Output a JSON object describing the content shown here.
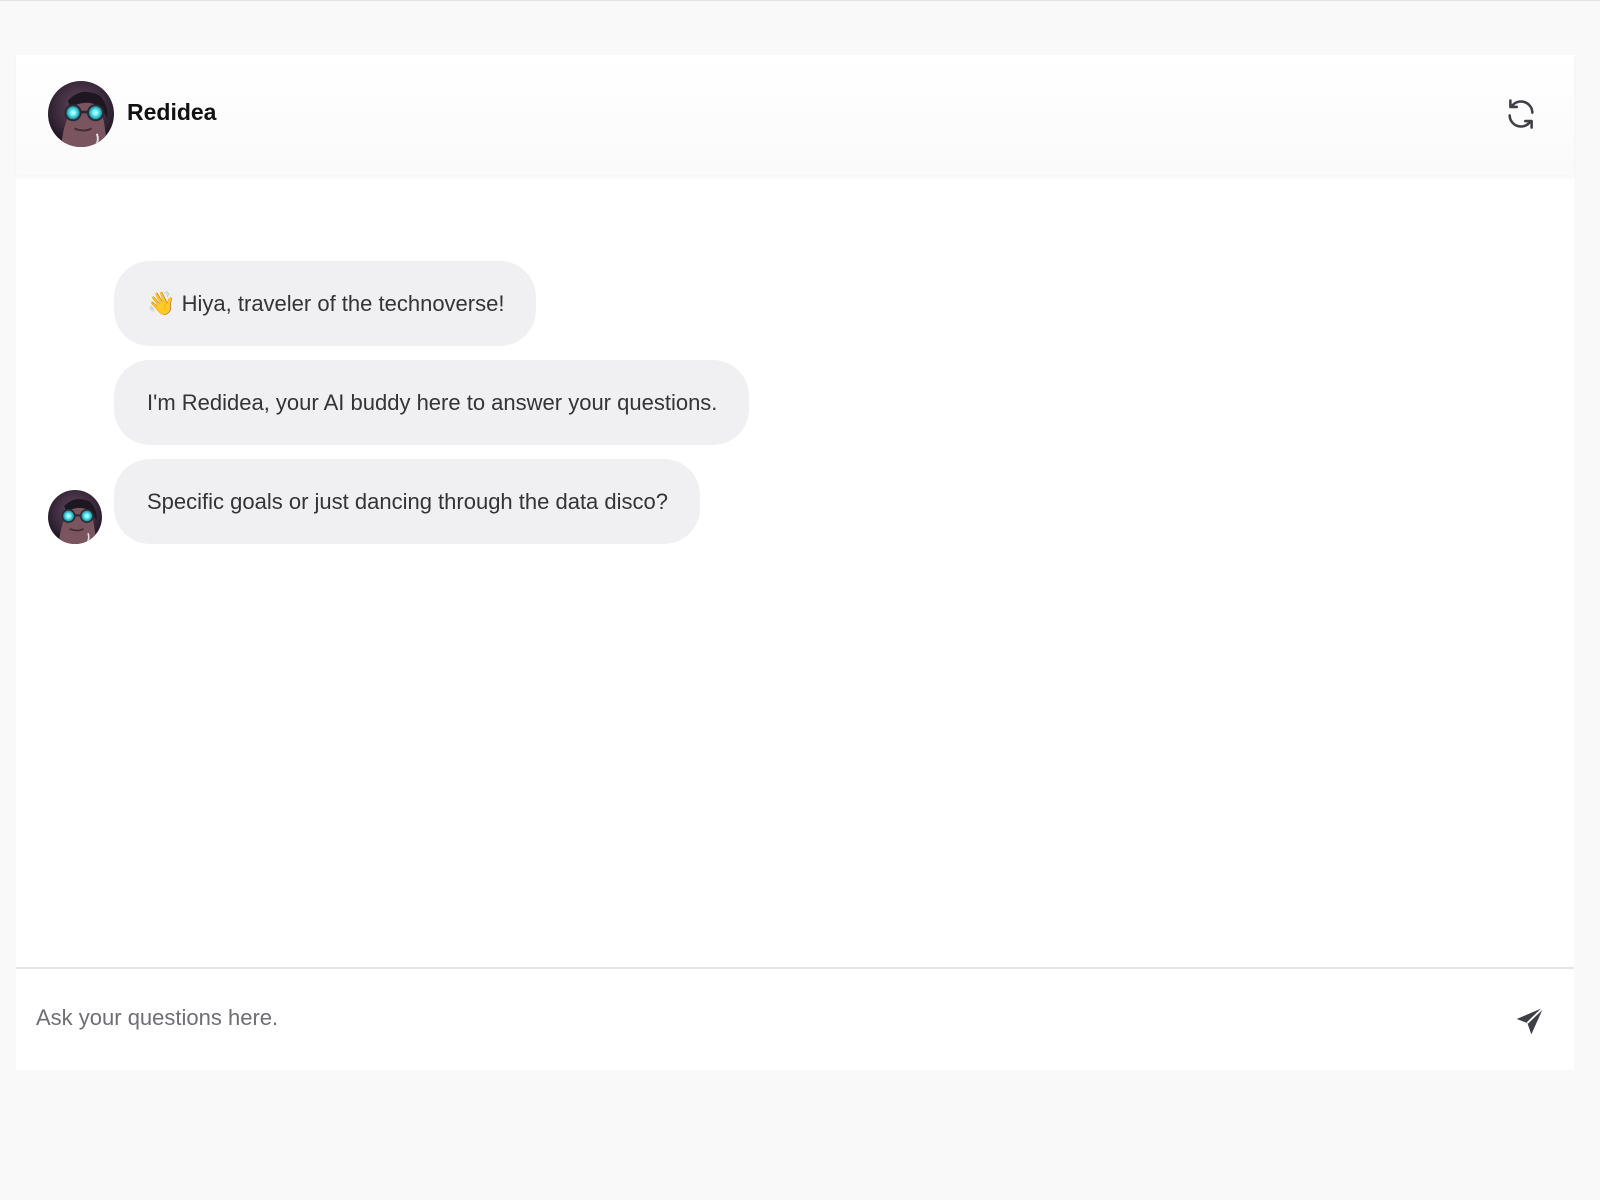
{
  "header": {
    "bot_name": "Redidea",
    "avatar_icon": "cyberpunk-goggles-avatar-icon",
    "refresh_icon": "refresh-icon"
  },
  "messages": [
    {
      "emoji": "👋",
      "text": "Hiya, traveler of the technoverse!"
    },
    {
      "text": "I'm Redidea, your AI buddy here to answer your questions."
    },
    {
      "text": "Specific goals or just dancing through the data disco?"
    }
  ],
  "composer": {
    "placeholder": "Ask your questions here.",
    "value": "",
    "send_icon": "send-icon"
  },
  "colors": {
    "page_background": "#f9f9f9",
    "panel_background": "#ffffff",
    "bubble_background": "#f0f0f2",
    "text": "#333338",
    "icon": "#3f3f46"
  }
}
